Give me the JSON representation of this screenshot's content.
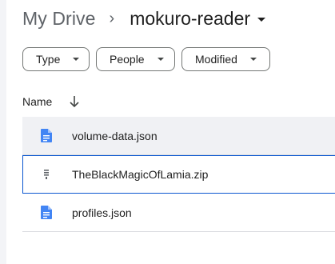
{
  "breadcrumb": {
    "root": "My Drive",
    "separator": "›",
    "current": "mokuro-reader"
  },
  "filters": [
    {
      "label": "Type"
    },
    {
      "label": "People"
    },
    {
      "label": "Modified"
    }
  ],
  "table": {
    "column_name": "Name",
    "sort": "descending",
    "rows": [
      {
        "name": "volume-data.json",
        "icon": "doc-icon",
        "state": "hover"
      },
      {
        "name": "TheBlackMagicOfLamia.zip",
        "icon": "zip-icon",
        "state": "selected"
      },
      {
        "name": "profiles.json",
        "icon": "doc-icon",
        "state": "normal"
      }
    ]
  },
  "colors": {
    "doc_icon": "#4285f4",
    "zip_icon": "#5f6368",
    "selected_border": "#0b57d0",
    "hover_bg": "#f0f1f4"
  }
}
